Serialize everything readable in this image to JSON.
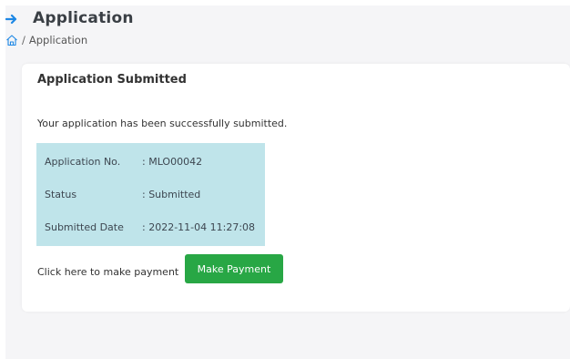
{
  "header": {
    "title": "Application",
    "arrow_icon": "arrow-right-icon",
    "accent_color": "#1e88e5"
  },
  "breadcrumb": {
    "home_icon": "home-icon",
    "separator": "/",
    "current": "Application"
  },
  "card": {
    "title": "Application Submitted",
    "message": "Your application has been successfully submitted.",
    "info_bg_color": "#bfe4ea",
    "rows": [
      {
        "label": "Application No.",
        "value": ": MLO00042"
      },
      {
        "label": "Status",
        "value": ": Submitted"
      },
      {
        "label": "Submitted Date",
        "value": ": 2022-11-04 11:27:08"
      }
    ],
    "payment_prompt": "Click here to make payment",
    "payment_button_label": "Make Payment",
    "payment_button_color": "#28a745"
  }
}
